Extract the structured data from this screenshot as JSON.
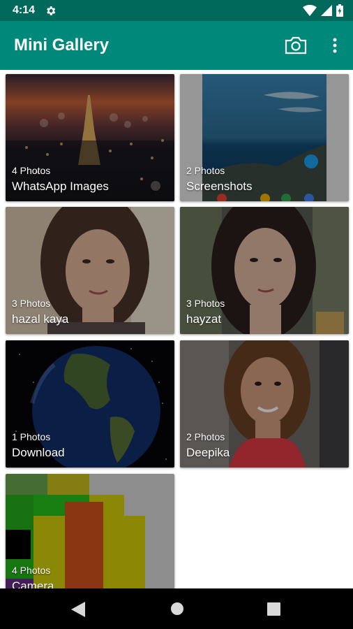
{
  "status_bar": {
    "time": "4:14",
    "icons": [
      "settings-icon",
      "wifi-icon",
      "signal-icon",
      "battery-icon"
    ]
  },
  "app_bar": {
    "title": "Mini Gallery",
    "actions": [
      "camera-icon",
      "more-vert-icon"
    ]
  },
  "albums": [
    {
      "count": "4 Photos",
      "name": "WhatsApp Images"
    },
    {
      "count": "2 Photos",
      "name": "Screenshots"
    },
    {
      "count": "3 Photos",
      "name": "hazal kaya"
    },
    {
      "count": "3 Photos",
      "name": "hayzat"
    },
    {
      "count": "1 Photos",
      "name": "Download"
    },
    {
      "count": "2 Photos",
      "name": "Deepika"
    },
    {
      "count": "4 Photos",
      "name": "Camera"
    }
  ],
  "nav_bar": {
    "buttons": [
      "back-icon",
      "home-icon",
      "recents-icon"
    ]
  },
  "colors": {
    "status_bar": "#00695c",
    "app_bar": "#00897b",
    "background": "#ffffff",
    "nav_bar": "#000000"
  }
}
